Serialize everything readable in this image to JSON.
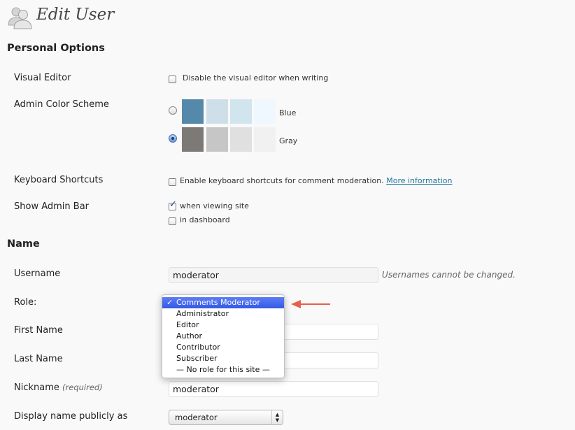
{
  "page": {
    "title": "Edit User",
    "title_icon": "users-icon"
  },
  "personal_options": {
    "heading": "Personal Options",
    "visual_editor": {
      "label": "Visual Editor",
      "checkbox_label": "Disable the visual editor when writing",
      "checked": false
    },
    "color_scheme": {
      "label": "Admin Color Scheme",
      "options": [
        {
          "name": "Blue",
          "selected": false,
          "colors": [
            "#5589aa",
            "#cfdfe9",
            "#d1e5ee",
            "#eff8ff"
          ]
        },
        {
          "name": "Gray",
          "selected": true,
          "colors": [
            "#7c7976",
            "#c6c6c6",
            "#e0e0e0",
            "#f1f1f1"
          ]
        }
      ]
    },
    "keyboard_shortcuts": {
      "label": "Keyboard Shortcuts",
      "checkbox_label": "Enable keyboard shortcuts for comment moderation.",
      "link": "More information",
      "checked": false
    },
    "admin_bar": {
      "label": "Show Admin Bar",
      "options": [
        {
          "label": "when viewing site",
          "checked": true
        },
        {
          "label": "in dashboard",
          "checked": false
        }
      ]
    }
  },
  "name": {
    "heading": "Name",
    "username": {
      "label": "Username",
      "value": "moderator",
      "hint": "Usernames cannot be changed."
    },
    "role": {
      "label": "Role:",
      "selected": "Comments Moderator",
      "options": [
        "Comments Moderator",
        "Administrator",
        "Editor",
        "Author",
        "Contributor",
        "Subscriber",
        "— No role for this site —"
      ]
    },
    "first_name": {
      "label": "First Name",
      "value": ""
    },
    "last_name": {
      "label": "Last Name",
      "value": ""
    },
    "nickname": {
      "label": "Nickname",
      "required": "(required)",
      "value": "moderator"
    },
    "display_name": {
      "label": "Display name publicly as",
      "value": "moderator"
    }
  },
  "annotation": {
    "arrow_color": "#e8604c",
    "accent": "#3559e6",
    "link_color": "#21759b"
  }
}
